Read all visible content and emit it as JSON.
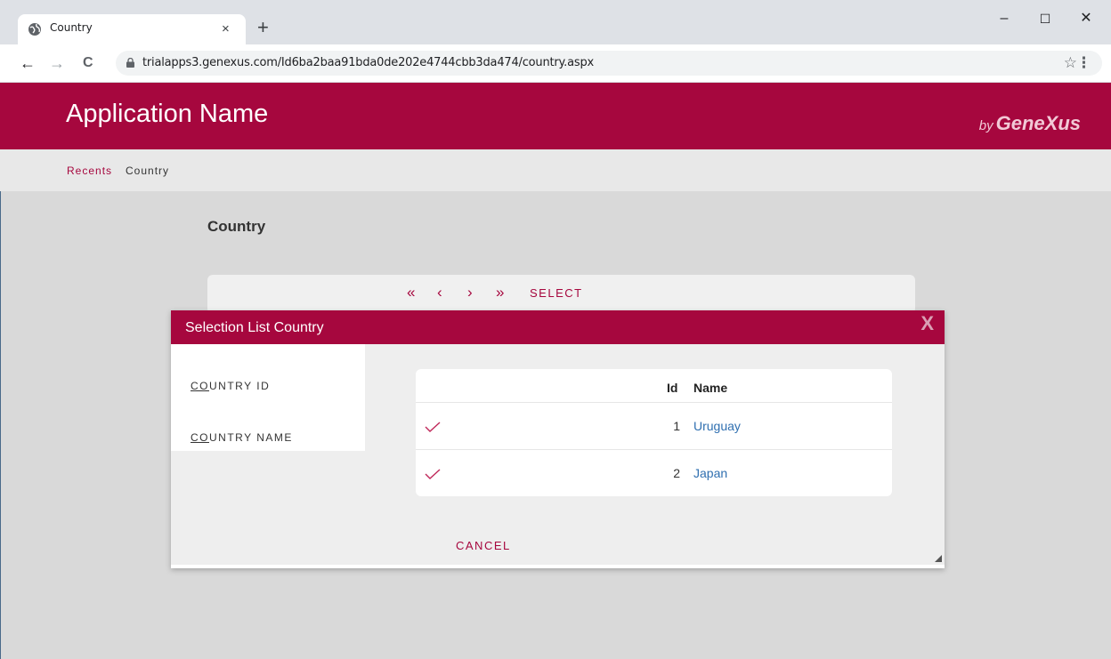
{
  "browser": {
    "tab_title": "Country",
    "tab_close": "×",
    "new_tab": "+",
    "url": "trialapps3.genexus.com/Id6ba2baa91bda0de202e4744cbb3da474/country.aspx",
    "window_controls": {
      "minimize": "–",
      "maximize": "☐",
      "close": "✕"
    },
    "nav": {
      "back": "←",
      "forward": "→",
      "reload": "C"
    },
    "star": "☆",
    "menu": "⋮"
  },
  "app": {
    "name": "Application Name",
    "brand_by": "by",
    "brand": "GeneXus",
    "accent_color": "#a6073e"
  },
  "breadcrumb": {
    "recents": "Recents",
    "current": "Country"
  },
  "page": {
    "title": "Country",
    "pager": {
      "first": "«",
      "prev": "‹",
      "next": "›",
      "last": "»"
    },
    "select_label": "SELECT"
  },
  "dialog": {
    "title": "Selection List Country",
    "close": "X",
    "filters": [
      {
        "underlined": "CO",
        "rest": "UNTRY ID"
      },
      {
        "underlined": "CO",
        "rest": "UNTRY NAME"
      }
    ],
    "grid": {
      "columns": [
        "Id",
        "Name"
      ],
      "rows": [
        {
          "id": "1",
          "name": "Uruguay"
        },
        {
          "id": "2",
          "name": "Japan"
        }
      ]
    },
    "cancel_label": "CANCEL"
  }
}
